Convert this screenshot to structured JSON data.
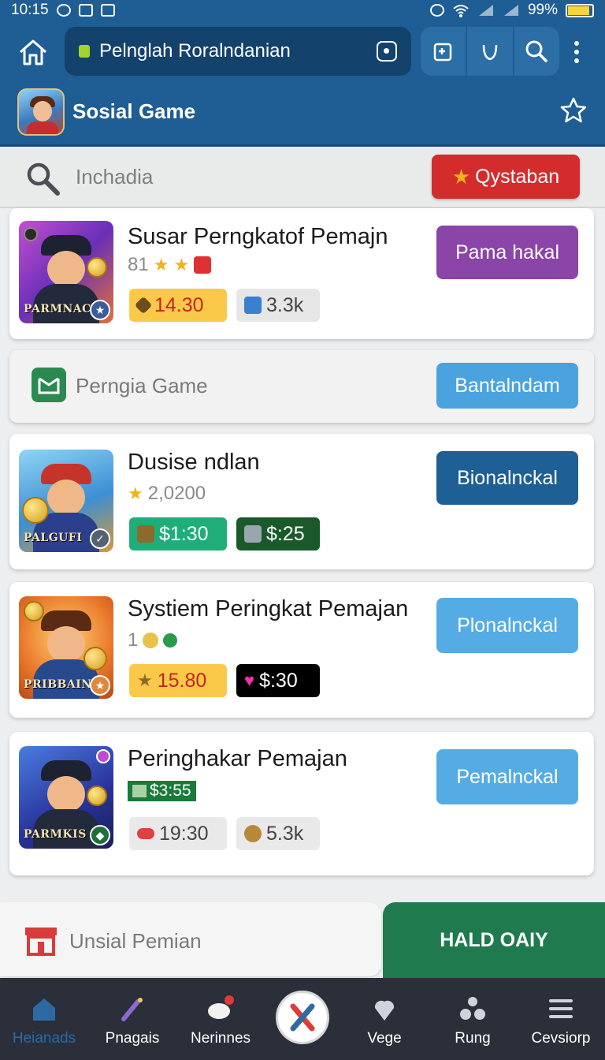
{
  "status_bar": {
    "time": "10:15",
    "battery": "99%"
  },
  "browser": {
    "url_text": "Pelnglah Roralndanian"
  },
  "app": {
    "title": "Sosial Game"
  },
  "search": {
    "placeholder": "Inchadia",
    "cta_label": "Qystaban"
  },
  "cards": [
    {
      "title": "Susar Perngkatof Pemajn",
      "meta": "81",
      "thumb_label": "PARMNAC",
      "chips": [
        "14.30",
        "3.3k"
      ],
      "button": "Pama hakal",
      "button_color": "#8b44a7"
    },
    {
      "title": "Perngia Game",
      "button": "Bantalndam",
      "button_color": "#4aa3df"
    },
    {
      "title": "Dusise ndlan",
      "meta": "2,0200",
      "thumb_label": "PALGUFI",
      "chips": [
        "$1:30",
        "$:25"
      ],
      "button": "Bionalnckal",
      "button_color": "#1e5f96"
    },
    {
      "title": "Systiem Peringkat Pemajan",
      "meta": "1",
      "thumb_label": "PRIBBAIN",
      "chips": [
        "15.80",
        "$:30"
      ],
      "button": "Plonalnckal",
      "button_color": "#55ace4"
    },
    {
      "title": "Peringhakar Pemajan",
      "meta": "$3:55",
      "thumb_label": "PARMKIS",
      "chips": [
        "19:30",
        "5.3k"
      ],
      "button": "Pemalnckal",
      "button_color": "#55ace4"
    }
  ],
  "banner": {
    "label": "Unsial Pemian",
    "action": "HALD OAIY"
  },
  "nav": {
    "items": [
      "Heianads",
      "Pnagais",
      "Nerinnes",
      "Vege",
      "Rung",
      "Cevsiorp"
    ],
    "active_color": "#2d6aa4"
  }
}
